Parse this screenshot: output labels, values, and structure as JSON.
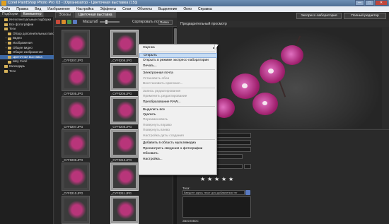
{
  "window": {
    "title": "Corel PaintShop Photo Pro X3 - [Организатор - Цветочная выставка (15)]",
    "minimize": "—",
    "maximize": "□",
    "close": "✕"
  },
  "menubar": [
    "Файл",
    "Правка",
    "Вид",
    "Изображение",
    "Настройка",
    "Эффекты",
    "Слои",
    "Объекты",
    "Выделение",
    "Окно",
    "Справка"
  ],
  "left_panel": {
    "tabs": [
      "Подборки",
      "Компьютер"
    ],
    "active_tab": 1,
    "tree": [
      {
        "label": "Интеллектуальные подборки",
        "level": 0,
        "expand": ""
      },
      {
        "label": "Все фотографии",
        "level": 0,
        "expand": ""
      },
      {
        "label": "Теги",
        "level": 0,
        "expand": ""
      },
      {
        "label": "Обзор дополнительных папок",
        "level": 1,
        "expand": ""
      },
      {
        "label": "Видео",
        "level": 1,
        "expand": "+"
      },
      {
        "label": "Изображения",
        "level": 1,
        "expand": "+"
      },
      {
        "label": "Общее видео",
        "level": 1,
        "expand": "+"
      },
      {
        "label": "Общие изображения",
        "level": 1,
        "expand": "+"
      },
      {
        "label": "Цветочная выставка",
        "level": 1,
        "expand": "",
        "selected": true
      },
      {
        "label": "Шоу Corel",
        "level": 1,
        "expand": ""
      },
      {
        "label": "Календарь",
        "level": 0,
        "expand": ""
      },
      {
        "label": "Теги",
        "level": 0,
        "expand": ""
      }
    ]
  },
  "center": {
    "tabs": [
      "Эскизы",
      "Цветочная выставка"
    ],
    "toolbar": {
      "zoom_label": "Масштаб",
      "sort_label": "Сортировать по:",
      "sort_value": "Папка"
    },
    "thumbnails": [
      {
        "caption": "_CYF0207.JPG",
        "selected": false
      },
      {
        "caption": "_CYF0208.JPG",
        "selected": true
      },
      {
        "caption": "_CYF0205.JPG",
        "selected": false
      },
      {
        "caption": "_CYF0206.JPG",
        "selected": true
      },
      {
        "caption": "_CYF0207.JPG",
        "selected": false
      },
      {
        "caption": "_CYF0208.JPG",
        "selected": true
      },
      {
        "caption": "_CYF0209.JPG",
        "selected": false
      },
      {
        "caption": "_CYF0210.JPG",
        "selected": true
      },
      {
        "caption": "_CYF0210.JPG",
        "selected": false
      },
      {
        "caption": "_CYF0211.JPG",
        "selected": true
      },
      {
        "caption": "_CYF0211.JPG",
        "selected": false
      },
      {
        "caption": "_CYF0212.JPG",
        "selected": true
      }
    ]
  },
  "preview": {
    "header": "Предварительный просмотр",
    "express_button": "Экспресс-лаборатория",
    "full_editor_button": "Полный редактор"
  },
  "info": {
    "stars": [
      "★",
      "★",
      "★",
      "★",
      "★"
    ],
    "tags_label": "Теги:",
    "tags_placeholder": "Введите здесь текст для добавления тег",
    "caption_label": "Заголовок:"
  },
  "context_menu": {
    "items": [
      {
        "label": "Оценка",
        "disabled": false,
        "submenu": true
      },
      {
        "label": "Открыть",
        "disabled": false,
        "highlighted": true
      },
      {
        "label": "Открыть в режиме экспресс-лаборатории",
        "disabled": false
      },
      {
        "label": "Печать...",
        "disabled": false
      },
      {
        "label": "Электронная почта",
        "disabled": false
      },
      {
        "label": "Установить обои",
        "disabled": true
      },
      {
        "label": "Восстановить оригинал...",
        "disabled": true
      },
      {
        "label": "Запись редактирования",
        "disabled": true
      },
      {
        "label": "Применить редактирование",
        "disabled": true
      },
      {
        "label": "Преобразование RAW...",
        "disabled": false
      },
      {
        "label": "Выделить все",
        "disabled": false
      },
      {
        "label": "Удалить",
        "disabled": false
      },
      {
        "label": "Переименовать",
        "disabled": true
      },
      {
        "label": "Повернуть вправо",
        "disabled": true
      },
      {
        "label": "Повернуть влево",
        "disabled": true
      },
      {
        "label": "Настройка даты создания",
        "disabled": true
      },
      {
        "label": "Добавить в область мультимедиа",
        "disabled": false
      },
      {
        "label": "Просмотреть сведения о фотографии",
        "disabled": false
      },
      {
        "label": "Обновить",
        "disabled": false
      },
      {
        "label": "Настройка...",
        "disabled": false
      }
    ]
  },
  "icons": {
    "app": "paintshop-app-icon",
    "folder": "folder-icon",
    "submenu": "▸"
  }
}
